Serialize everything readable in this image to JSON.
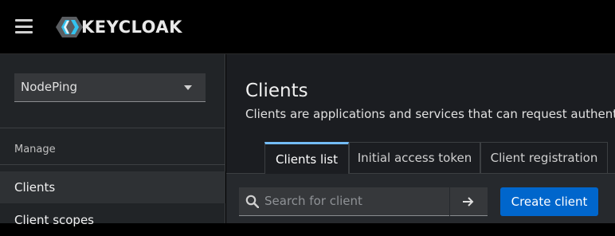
{
  "brand": {
    "name": "KEYCLOAK"
  },
  "realm_selector": {
    "selected": "NodePing"
  },
  "sidebar": {
    "section_title": "Manage",
    "items": [
      {
        "label": "Clients"
      },
      {
        "label": "Client scopes"
      }
    ]
  },
  "main": {
    "title": "Clients",
    "description": "Clients are applications and services that can request authentication of a user.",
    "tabs": [
      {
        "label": "Clients list"
      },
      {
        "label": "Initial access token"
      },
      {
        "label": "Client registration"
      }
    ],
    "search": {
      "placeholder": "Search for client"
    },
    "create_button": "Create client"
  },
  "colors": {
    "accent": "#0066cc",
    "tab_active": "#73bcf7"
  }
}
